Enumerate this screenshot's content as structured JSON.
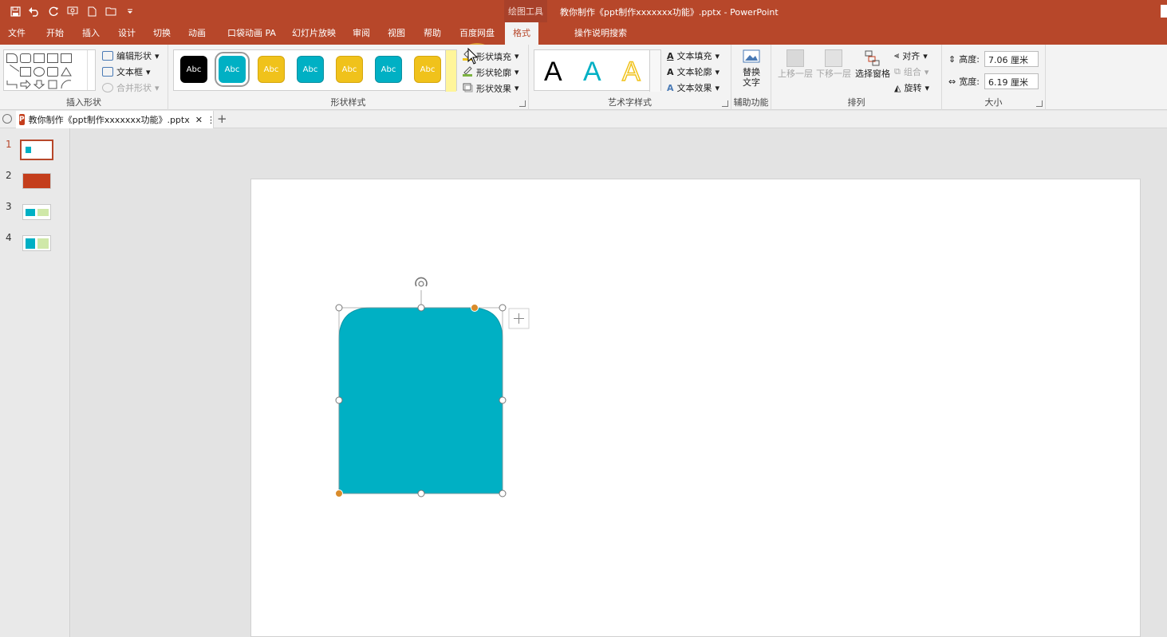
{
  "app": {
    "contextual_tools": "绘图工具",
    "document_title": "教你制作《ppt制作xxxxxxx功能》.pptx  -  PowerPoint"
  },
  "colors": {
    "accent": "#b7472a",
    "teal": "#00b0c4",
    "gold": "#f0c21b",
    "handle_orange": "#d98b2b"
  },
  "tabs": [
    {
      "label": "文件"
    },
    {
      "label": "开始"
    },
    {
      "label": "插入"
    },
    {
      "label": "设计"
    },
    {
      "label": "切换"
    },
    {
      "label": "动画"
    },
    {
      "label": "口袋动画 PA"
    },
    {
      "label": "幻灯片放映"
    },
    {
      "label": "审阅"
    },
    {
      "label": "视图"
    },
    {
      "label": "帮助"
    },
    {
      "label": "百度网盘"
    },
    {
      "label": "格式"
    }
  ],
  "tell_me": "操作说明搜索",
  "ribbon": {
    "insert_shapes": {
      "label": "插入形状",
      "edit_shape": "编辑形状",
      "text_box": "文本框",
      "merge_shapes": "合并形状"
    },
    "shape_styles": {
      "label": "形状样式",
      "swatch_text": "Abc",
      "shape_fill": "形状填充",
      "shape_outline": "形状轮廓",
      "shape_effects": "形状效果"
    },
    "wordart_styles": {
      "label": "艺术字样式",
      "letter": "A",
      "text_fill": "文本填充",
      "text_outline": "文本轮廓",
      "text_effects": "文本效果"
    },
    "accessibility": {
      "label": "辅助功能",
      "alt_text_line1": "替换",
      "alt_text_line2": "文字"
    },
    "arrange": {
      "label": "排列",
      "bring_forward": "上移一层",
      "send_backward": "下移一层",
      "selection_pane": "选择窗格",
      "align": "对齐",
      "group": "组合",
      "rotate": "旋转"
    },
    "size": {
      "label": "大小",
      "height_label": "高度:",
      "height_value": "7.06 厘米",
      "width_label": "宽度:",
      "width_value": "6.19 厘米"
    }
  },
  "doc_tab": {
    "filename": "教你制作《ppt制作xxxxxxx功能》.pptx",
    "badge": "P"
  },
  "slides": [
    {
      "number": "1"
    },
    {
      "number": "2"
    },
    {
      "number": "3"
    },
    {
      "number": "4"
    }
  ]
}
